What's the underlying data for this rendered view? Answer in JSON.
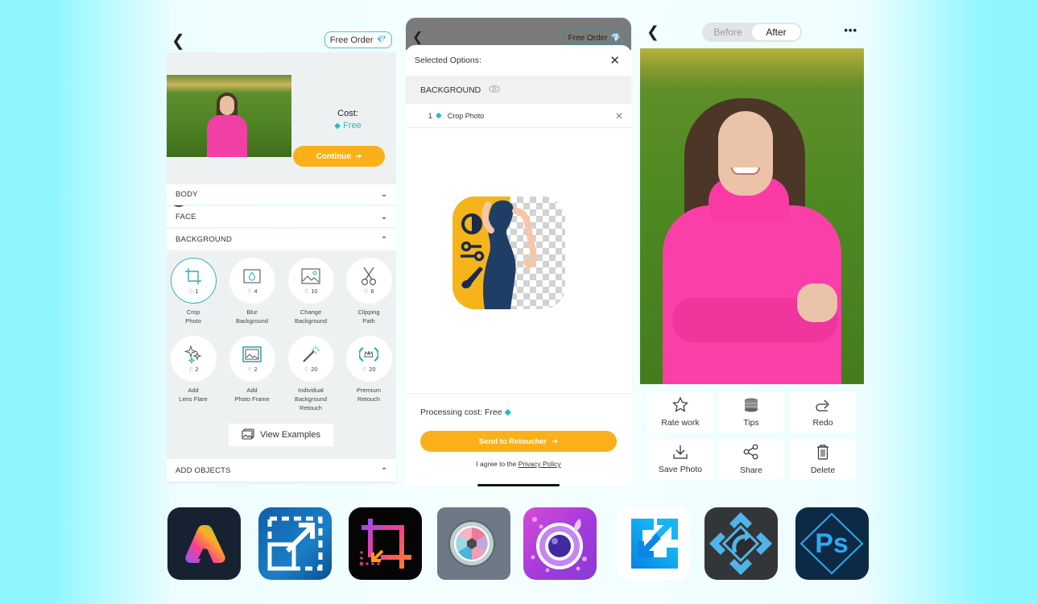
{
  "colors": {
    "accent_orange": "#fbb01a",
    "accent_teal": "#2cb8c0",
    "sweater_pink": "#fb3fa8"
  },
  "panel1": {
    "back_icon": "chevron-left-icon",
    "free_order_label": "Free Order",
    "cost_label": "Cost:",
    "cost_value": "Free",
    "continue_label": "Continue",
    "sections": [
      {
        "label": "BODY",
        "expanded": false
      },
      {
        "label": "FACE",
        "expanded": false
      },
      {
        "label": "BACKGROUND",
        "expanded": true
      },
      {
        "label": "ADD OBJECTS",
        "expanded": true
      }
    ],
    "options": [
      {
        "label": "Crop\nPhoto",
        "price": "1",
        "icon": "crop-icon",
        "selected": true
      },
      {
        "label": "Blur\nBackground",
        "price": "4",
        "icon": "blur-drop-icon",
        "selected": false
      },
      {
        "label": "Change\nBackground",
        "price": "10",
        "icon": "image-icon",
        "selected": false
      },
      {
        "label": "Clipping\nPath",
        "price": "8",
        "icon": "scissors-icon",
        "selected": false
      },
      {
        "label": "Add\nLens Flare",
        "price": "2",
        "icon": "sparkles-icon",
        "selected": false
      },
      {
        "label": "Add\nPhoto Frame",
        "price": "2",
        "icon": "photo-frame-icon",
        "selected": false
      },
      {
        "label": "Individual\nBackground\nRetouch",
        "price": "20",
        "icon": "magic-wand-icon",
        "selected": false
      },
      {
        "label": "Premium\nRetouch",
        "price": "20",
        "icon": "crown-laurel-icon",
        "selected": false
      }
    ],
    "view_examples_label": "View Examples"
  },
  "panel2": {
    "free_order_label": "Free Order",
    "title": "Selected Options:",
    "section_label": "BACKGROUND",
    "selected_item": {
      "count": "1",
      "label": "Crop Photo"
    },
    "processing_cost": "Processing cost: Free",
    "send_label": "Send to Retoucher",
    "agree_text": "I agree to the",
    "privacy_link": "Privacy Policy"
  },
  "panel3": {
    "toggle": {
      "before": "Before",
      "after": "After",
      "active": "After"
    },
    "more_label": "•••",
    "actions": [
      {
        "label": "Rate work",
        "icon": "star-icon"
      },
      {
        "label": "Tips",
        "icon": "coins-icon"
      },
      {
        "label": "Redo",
        "icon": "redo-icon"
      },
      {
        "label": "Save Photo",
        "icon": "download-icon"
      },
      {
        "label": "Share",
        "icon": "share-icon"
      },
      {
        "label": "Delete",
        "icon": "trash-icon"
      }
    ]
  },
  "apps": [
    {
      "name": "adobe-express"
    },
    {
      "name": "image-resizer-blue"
    },
    {
      "name": "crop-gradient"
    },
    {
      "name": "pixlr-lens"
    },
    {
      "name": "youcam-perfect"
    },
    {
      "name": "resize-arrows"
    },
    {
      "name": "rotate-diamond"
    },
    {
      "name": "photoshop-express",
      "text": "Ps"
    }
  ]
}
